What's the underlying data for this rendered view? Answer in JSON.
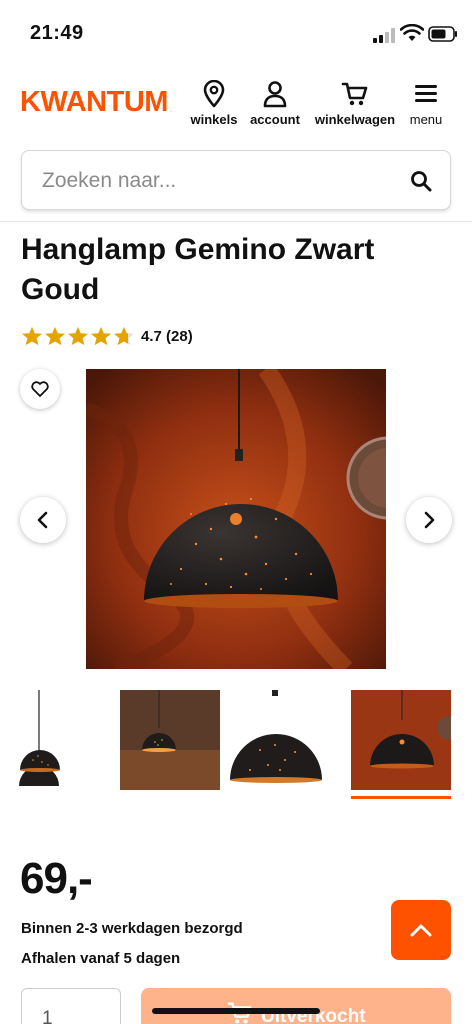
{
  "status_bar": {
    "time": "21:49"
  },
  "header": {
    "logo": "KWANTUM",
    "nav": [
      {
        "label": "winkels",
        "icon": "location-pin-icon"
      },
      {
        "label": "account",
        "icon": "user-icon"
      },
      {
        "label": "winkelwagen",
        "icon": "cart-icon"
      },
      {
        "label": "menu",
        "icon": "hamburger-menu-icon"
      }
    ]
  },
  "search": {
    "placeholder": "Zoeken naar..."
  },
  "product": {
    "title": "Hanglamp Gemino Zwart Goud",
    "rating": {
      "stars": 4.7,
      "text": "4.7 (28)"
    },
    "price": "69,-",
    "delivery": "Binnen 2-3 werkdagen bezorgd",
    "pickup": "Afhalen vanaf 5 dagen"
  },
  "gallery": {
    "active_index": 3,
    "thumb_count": 4
  },
  "purchase": {
    "quantity": "1",
    "button_label": "Uitverkocht"
  },
  "colors": {
    "accent": "#ff5200",
    "button_disabled": "#ffb38a",
    "star": "#e3a400"
  }
}
